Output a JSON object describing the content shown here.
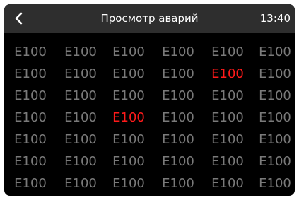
{
  "header": {
    "back_icon": "chevron-left-icon",
    "title": "Просмотр аварий",
    "time": "13:40"
  },
  "colors": {
    "background": "#000000",
    "header_bg": "#2e2e2e",
    "inactive_code": "#7a7a7a",
    "active_alarm": "#ff1a1a"
  },
  "grid": {
    "rows": [
      [
        {
          "code": "E100",
          "active": false
        },
        {
          "code": "E100",
          "active": false
        },
        {
          "code": "E100",
          "active": false
        },
        {
          "code": "E100",
          "active": false
        },
        {
          "code": "E100",
          "active": false
        },
        {
          "code": "E100",
          "active": false
        }
      ],
      [
        {
          "code": "E100",
          "active": false
        },
        {
          "code": "E100",
          "active": false
        },
        {
          "code": "E100",
          "active": false
        },
        {
          "code": "E100",
          "active": false
        },
        {
          "code": "E100",
          "active": true
        },
        {
          "code": "E100",
          "active": false
        }
      ],
      [
        {
          "code": "E100",
          "active": false
        },
        {
          "code": "E100",
          "active": false
        },
        {
          "code": "E100",
          "active": false
        },
        {
          "code": "E100",
          "active": false
        },
        {
          "code": "E100",
          "active": false
        },
        {
          "code": "E100",
          "active": false
        }
      ],
      [
        {
          "code": "E100",
          "active": false
        },
        {
          "code": "E100",
          "active": false
        },
        {
          "code": "E100",
          "active": true
        },
        {
          "code": "E100",
          "active": false
        },
        {
          "code": "E100",
          "active": false
        },
        {
          "code": "E100",
          "active": false
        }
      ],
      [
        {
          "code": "E100",
          "active": false
        },
        {
          "code": "E100",
          "active": false
        },
        {
          "code": "E100",
          "active": false
        },
        {
          "code": "E100",
          "active": false
        },
        {
          "code": "E100",
          "active": false
        },
        {
          "code": "E100",
          "active": false
        }
      ],
      [
        {
          "code": "E100",
          "active": false
        },
        {
          "code": "E100",
          "active": false
        },
        {
          "code": "E100",
          "active": false
        },
        {
          "code": "E100",
          "active": false
        },
        {
          "code": "E100",
          "active": false
        },
        {
          "code": "E100",
          "active": false
        }
      ],
      [
        {
          "code": "E100",
          "active": false
        },
        {
          "code": "E100",
          "active": false
        },
        {
          "code": "E100",
          "active": false
        },
        {
          "code": "E100",
          "active": false
        },
        {
          "code": "E100",
          "active": false
        },
        {
          "code": "E100",
          "active": false
        }
      ]
    ]
  }
}
